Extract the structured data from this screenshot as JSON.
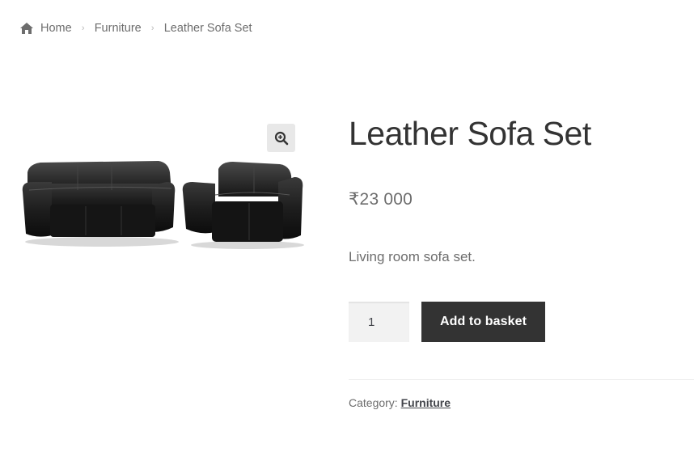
{
  "breadcrumb": {
    "home_icon": "home-icon",
    "items": [
      "Home",
      "Furniture",
      "Leather Sofa Set"
    ],
    "separator": "›"
  },
  "gallery": {
    "zoom_icon": "zoom-in-icon",
    "image_subject": "black leather sofa and loveseat"
  },
  "product": {
    "title": "Leather Sofa Set",
    "price": "₹23 000",
    "description": "Living room sofa set.",
    "quantity": "1",
    "add_to_basket_label": "Add to basket",
    "category_label": "Category:",
    "category_value": "Furniture"
  },
  "colors": {
    "button_bg": "#333333",
    "button_text": "#ffffff",
    "text_muted": "#6d6d6d"
  }
}
